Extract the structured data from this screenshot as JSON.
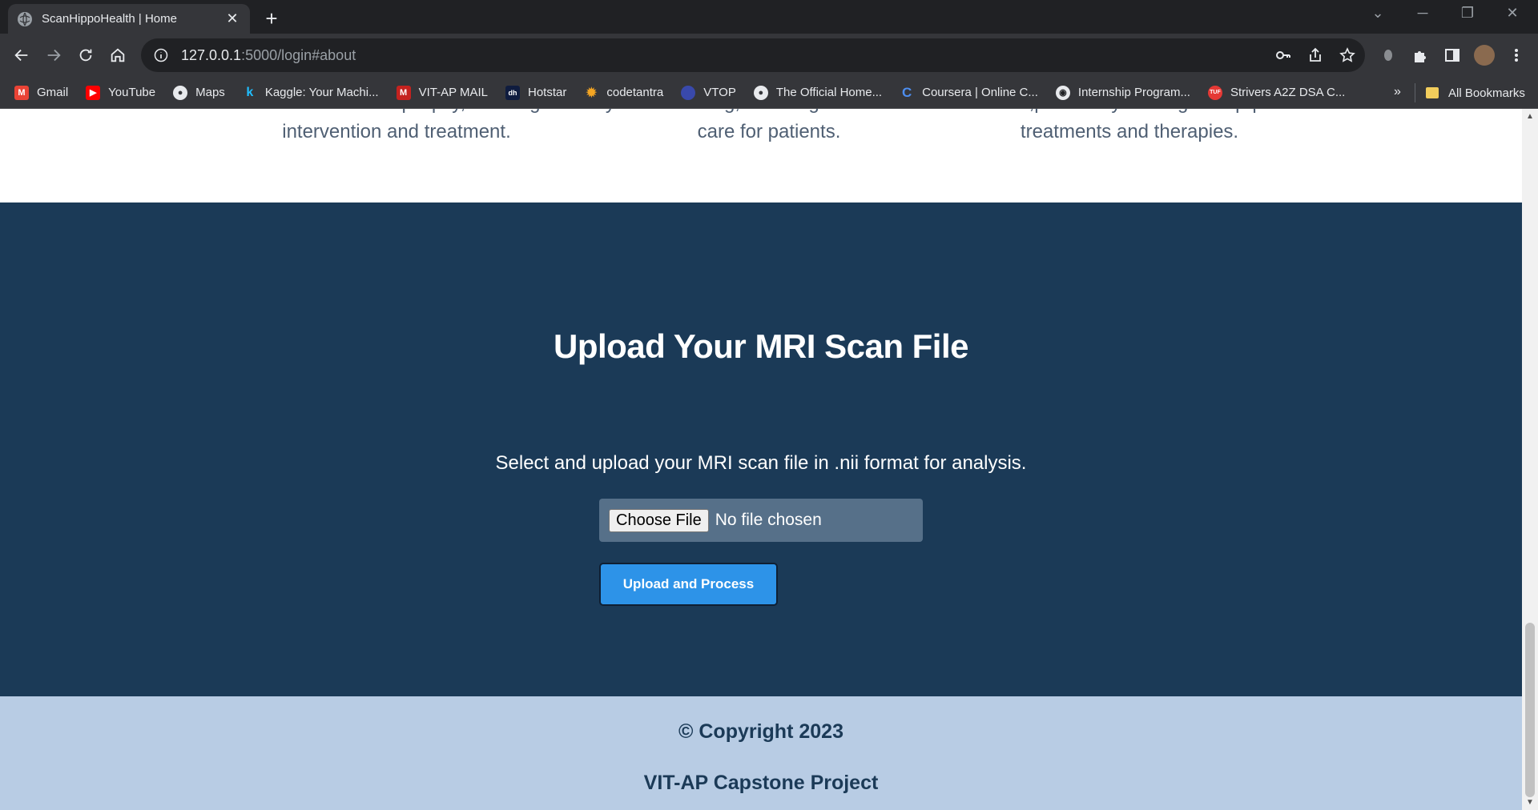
{
  "browser": {
    "tab_title": "ScanHippoHealth | Home",
    "new_tab_label": "+",
    "url_host": "127.0.0.1",
    "url_path": ":5000/login#about",
    "bookmarks": [
      {
        "label": "Gmail",
        "color": "#ea4335"
      },
      {
        "label": "YouTube",
        "color": "#ff0000"
      },
      {
        "label": "Maps",
        "color": "#5f6368"
      },
      {
        "label": "Kaggle: Your Machi...",
        "color": "#20beff"
      },
      {
        "label": "VIT-AP MAIL",
        "color": "#ea4335"
      },
      {
        "label": "Hotstar",
        "color": "#0f1c3f"
      },
      {
        "label": "codetantra",
        "color": "#f5a623"
      },
      {
        "label": "VTOP",
        "color": "#3949ab"
      },
      {
        "label": "The Official Home...",
        "color": "#5f6368"
      },
      {
        "label": "Coursera | Online C...",
        "color": "#0056d2"
      },
      {
        "label": "Internship Program...",
        "color": "#5f6368"
      },
      {
        "label": "Strivers A2Z DSA C...",
        "color": "#e53935"
      }
    ],
    "bookmarks_more": "»",
    "all_bookmarks": "All Bookmarks"
  },
  "features": {
    "col1_line1": "Alzheimer's disease and epilepsy, allowing for early",
    "col1_line2": "intervention and treatment.",
    "col2_line1": "monitoring, ensuring the best",
    "col2_line2": "care for patients.",
    "col3_line1": "research,potentially leading to imprpoved",
    "col3_line2": "treatments and therapies."
  },
  "upload": {
    "title": "Upload Your MRI Scan File",
    "description": "Select and upload your MRI scan file in .nii format for analysis.",
    "choose_file_label": "Choose File",
    "no_file_text": "No file chosen",
    "submit_label": "Upload and Process"
  },
  "footer": {
    "copyright": "© Copyright 2023",
    "project": "VIT-AP Capstone Project"
  },
  "colors": {
    "section_bg": "#1b3a57",
    "footer_bg": "#b8cce4",
    "button_bg": "#2d93e8"
  }
}
